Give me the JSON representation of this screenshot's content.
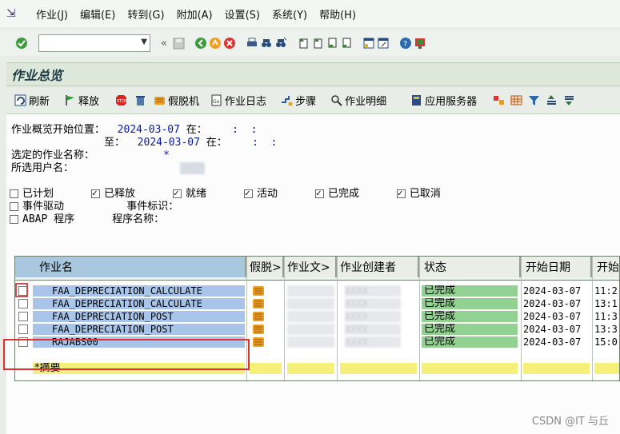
{
  "menu": {
    "items": [
      "作业(J)",
      "编辑(E)",
      "转到(G)",
      "附加(A)",
      "设置(S)",
      "系统(Y)",
      "帮助(H)"
    ]
  },
  "toolbar": {
    "command_value": ""
  },
  "title": "作业总览",
  "app_toolbar": {
    "refresh": "刷新",
    "release": "释放",
    "spool": "假脱机",
    "job_log": "作业日志",
    "step": "步骤",
    "job_details": "作业明细",
    "app_server": "应用服务器"
  },
  "filters": {
    "start_label": "作业概览开始位置：",
    "start_date": "2024-03-07",
    "at_label": "在：",
    "start_time": ":  :",
    "to_label": "至：",
    "end_date": "2024-03-07",
    "end_time": ":  :",
    "job_name_label": "选定的作业名称：",
    "job_name_value": "*",
    "user_label": "所选用户名：",
    "user_value": "XXXX"
  },
  "status_checks": [
    {
      "label": "已计划",
      "checked": false
    },
    {
      "label": "已释放",
      "checked": true
    },
    {
      "label": "就绪",
      "checked": true
    },
    {
      "label": "活动",
      "checked": true
    },
    {
      "label": "已完成",
      "checked": true
    },
    {
      "label": "已取消",
      "checked": true
    }
  ],
  "event_driven": {
    "label": "事件驱动",
    "checked": false,
    "event_id_label": "事件标识："
  },
  "abap_program": {
    "label": "ABAP 程序",
    "checked": false,
    "program_name_label": "程序名称："
  },
  "grid": {
    "columns": [
      "作业名",
      "假脱>",
      "作业文>",
      "作业创建者",
      "状态",
      "开始日期",
      "开始"
    ],
    "rows": [
      {
        "name": "FAA_DEPRECIATION_CALCULATE",
        "creator": "XXXX",
        "status": "已完成",
        "date": "2024-03-07",
        "time": "11:2"
      },
      {
        "name": "FAA_DEPRECIATION_CALCULATE",
        "creator": "XXXX",
        "status": "已完成",
        "date": "2024-03-07",
        "time": "13:1"
      },
      {
        "name": "FAA_DEPRECIATION_POST",
        "creator": "XXXX",
        "status": "已完成",
        "date": "2024-03-07",
        "time": "11:3"
      },
      {
        "name": "FAA_DEPRECIATION_POST",
        "creator": "XXXX",
        "status": "已完成",
        "date": "2024-03-07",
        "time": "13:3"
      },
      {
        "name": "RAJABS00",
        "creator": "XXXX",
        "status": "已完成",
        "date": "2024-03-07",
        "time": "15:0"
      }
    ],
    "summary_label": "*摘要"
  },
  "watermark": "CSDN @IT 与丘",
  "colors": {
    "selected_blue": "#a8c4e8",
    "status_green": "#92d192",
    "summary_yellow": "#f5f07a",
    "highlight_red": "#e03030"
  }
}
